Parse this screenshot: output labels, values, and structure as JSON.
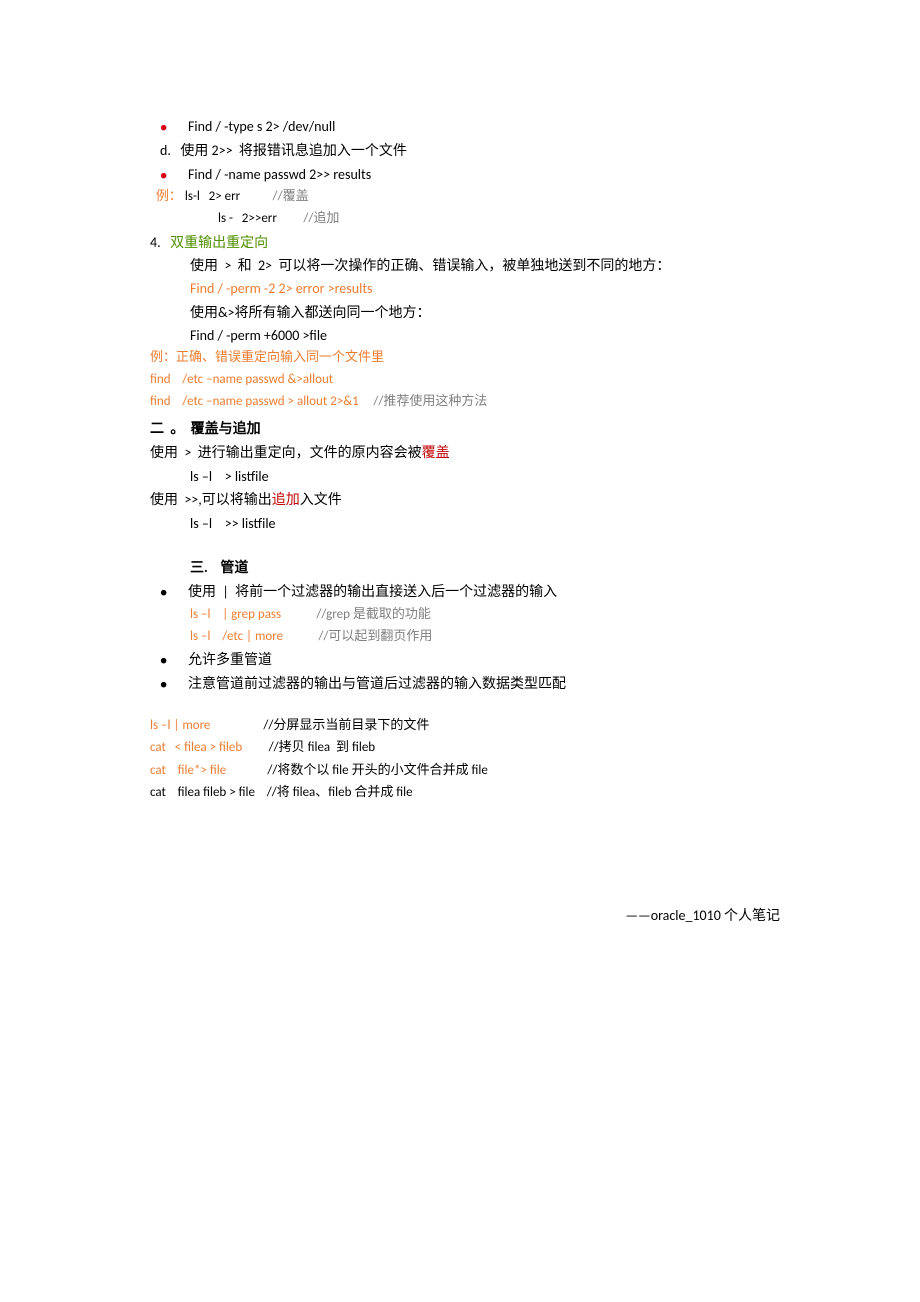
{
  "l1": "Find / -type s 2> /dev/null",
  "l2a": "d.   ",
  "l2b": "使用 2>>  将报错讯息追加入一个文件",
  "l3": "Find / -name passwd 2>> results",
  "l4a": "  例：",
  "l4b": " ls-l   2> err           ",
  "l4c": "//覆盖",
  "l5a": "ls -   2>>err         ",
  "l5b": "//追加",
  "l6a": "4.   ",
  "l6b": "双重输出重定向",
  "l7": "使用  >  和  2>  可以将一次操作的正确、错误输入，被单独地送到不同的地方：",
  "l8": "Find / -perm -2 2> error >results",
  "l9": "使用&>将所有输入都送向同一个地方：",
  "l10": "Find / -perm +6000 >file",
  "l11": "例：正确、错误重定向输入同一个文件里",
  "l12": "find    /etc –name passwd &>allout",
  "l13a": "find    /etc –name passwd > allout 2>&1     ",
  "l13b": "//推荐使用这种方法",
  "l14": "二  。  覆盖与追加",
  "l15a": "使用  >  进行输出重定向，文件的原内容会被",
  "l15b": "覆盖",
  "l16": "ls –l    > listfile",
  "l17a": "使用  >>,可以将输出",
  "l17b": "追加",
  "l17c": "入文件",
  "l18": "ls –l    >> listfile",
  "l19": "三.    管道",
  "l20": "使用  |  将前一个过滤器的输出直接送入后一个过滤器的输入",
  "l21a": "ls –l    | grep pass            ",
  "l21b": "//grep 是截取的功能",
  "l22a": "ls –l    /etc | more            ",
  "l22b": "//可以起到翻页作用",
  "l23": "允许多重管道",
  "l24": "注意管道前过滤器的输出与管道后过滤器的输入数据类型匹配",
  "l25a": "ls –l | more                  ",
  "l25b": "//分屏显示当前目录下的文件",
  "l26a": "cat   < filea > fileb         ",
  "l26b": "//拷贝 filea  到 fileb",
  "l27a": "cat    file*> file              ",
  "l27b": "//将数个以 file 开头的小文件合并成 file",
  "l28a": "cat    filea fileb > file    ",
  "l28b": "//将 filea、fileb 合并成 file",
  "footer": "——oracle_1010 个人笔记"
}
